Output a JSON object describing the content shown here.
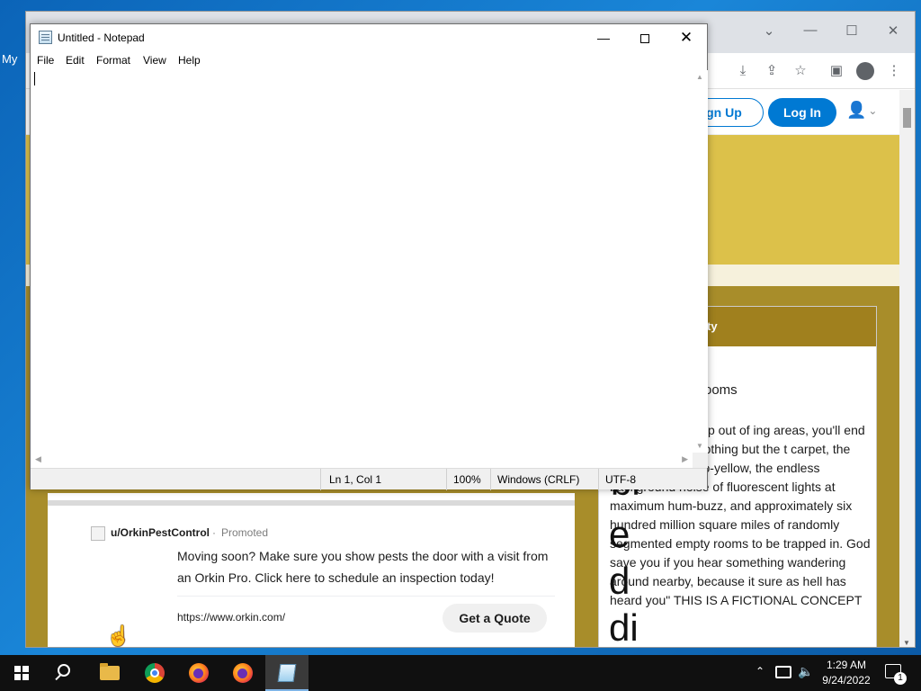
{
  "desktop": {
    "label": "My"
  },
  "browser": {
    "header": {
      "signup_label": "ign Up",
      "login_label": "Log In"
    },
    "sidebar": {
      "head_text": "ty",
      "title": "rooms",
      "description": "eful and you noclip out of ing areas, you'll end up in where it's nothing but the t carpet, the madness of mono-yellow, the endless background noise of fluorescent lights at maximum hum-buzz, and approximately six hundred million square miles of randomly segmented empty rooms to be trapped in. God save you if you hear something wandering around nearby, because it sure as hell has heard you\" THIS IS A FICTIONAL CONCEPT"
    },
    "promo": {
      "user": "u/OrkinPestControl",
      "separator": "·",
      "tag": "Promoted",
      "text": "Moving soon? Make sure you show pests the door with a visit from an Orkin Pro. Click here to schedule an inspection today!",
      "url": "https://www.orkin.com/",
      "cta_label": "Get a Quote"
    },
    "overlay_glyphs": [
      "bl",
      "e",
      "d",
      "di"
    ]
  },
  "notepad": {
    "title": "Untitled - Notepad",
    "menu": [
      "File",
      "Edit",
      "Format",
      "View",
      "Help"
    ],
    "content": "",
    "status": {
      "position": "Ln 1, Col 1",
      "zoom": "100%",
      "line_ending": "Windows (CRLF)",
      "encoding": "UTF-8"
    }
  },
  "taskbar": {
    "apps": [
      "start",
      "search",
      "file-explorer",
      "chrome",
      "firefox",
      "firefox",
      "notepad"
    ],
    "active_app": "notepad",
    "clock": {
      "time": "1:29 AM",
      "date": "9/24/2022"
    },
    "notification_count": "1"
  }
}
